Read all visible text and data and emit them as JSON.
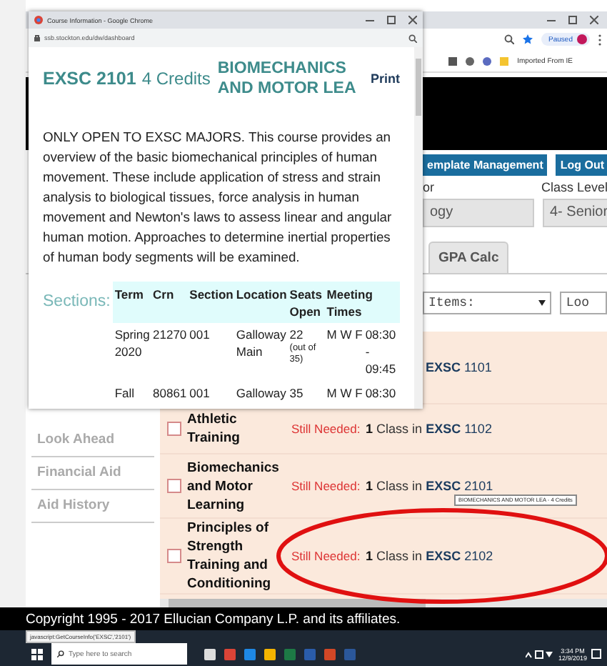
{
  "background_window": {
    "profile": "Paused",
    "bookmark_folder": "Imported From IE"
  },
  "header_buttons": [
    "emplate Management",
    "Log Out"
  ],
  "fields": [
    {
      "label": "or",
      "value": "ogy"
    },
    {
      "label": "Class Level",
      "value": "4- Senior"
    }
  ],
  "tabs": [
    {
      "label": "GPA Calc",
      "selected": false
    }
  ],
  "filter": {
    "select": "Items:",
    "field": "Loo"
  },
  "nav": [
    "Look Ahead",
    "Financial Aid",
    "Aid History"
  ],
  "requirements": [
    {
      "subject": "EXSC",
      "number": "1101"
    },
    {
      "course": "Athletic Training",
      "checked": false,
      "status": "Still Needed:",
      "count": "1",
      "text": "Class in",
      "subject": "EXSC",
      "number": "1102"
    },
    {
      "course": "Biomechanics and Motor Learning",
      "checked": false,
      "status": "Still Needed:",
      "count": "1",
      "text": "Class in",
      "subject": "EXSC",
      "number": "2101"
    },
    {
      "course": "Principles of Strength Training and Conditioning",
      "checked": false,
      "status": "Still Needed:",
      "count": "1",
      "text": "Class in",
      "subject": "EXSC",
      "number": "2102"
    }
  ],
  "tooltip": "BIOMECHANICS AND MOTOR LEA - 4 Credits",
  "footer": "Copyright 1995 - 2017 Ellucian Company L.P. and its affiliates.",
  "status_url": "javascript:GetCourseInfo('EXSC','2101')",
  "taskbar": {
    "search_placeholder": "Type here to search",
    "time": "3:34 PM",
    "date": "12/9/2019"
  },
  "popup": {
    "title": "Course Information - Google Chrome",
    "url": "ssb.stockton.edu/dw/dashboard",
    "subject": "EXSC",
    "number": "2101",
    "credits": "4 Credits",
    "course_title": "BIOMECHANICS AND MOTOR LEA",
    "print": "Print",
    "description": "ONLY OPEN TO EXSC MAJORS. This course provides an overview of the basic biomechanical principles of human movement. These include application of stress and strain analysis to biological tissues, force analysis in human movement and Newton's laws to assess linear and angular human motion. Approaches to determine inertial properties of human body segments will be examined.",
    "sections_label": "Sections:",
    "columns": [
      "Term",
      "Crn",
      "Section",
      "Location",
      "Seats Open",
      "Meeting Times"
    ],
    "rows": [
      {
        "term": "Spring 2020",
        "crn": "21270",
        "section": "001",
        "location": "Galloway Main",
        "seats": "22",
        "seats_note": "(out of 35)",
        "days": "M W F",
        "time": "08:30 - 09:45"
      },
      {
        "term": "Fall",
        "crn": "80861",
        "section": "001",
        "location": "Galloway",
        "seats": "35",
        "days": "M W F",
        "time": "08:30"
      }
    ]
  }
}
